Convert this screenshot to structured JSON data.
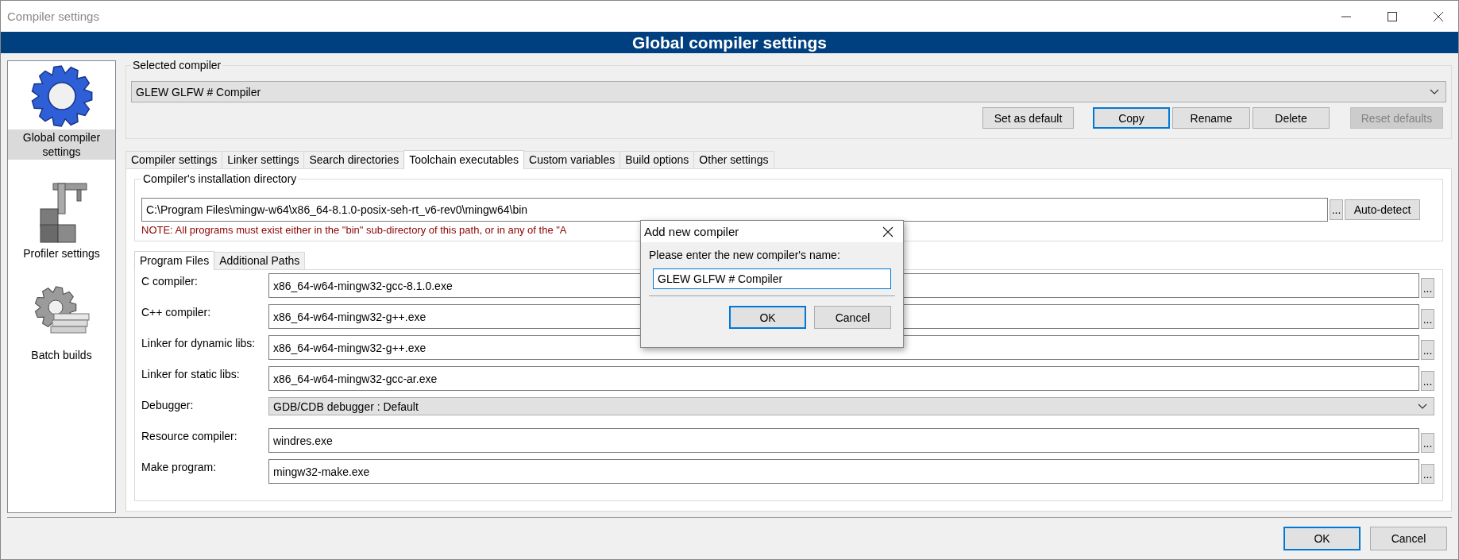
{
  "window": {
    "title": "Compiler settings"
  },
  "header": {
    "title": "Global compiler settings"
  },
  "sidebar": {
    "items": [
      {
        "label": "Global compiler settings",
        "selected": true
      },
      {
        "label": "Profiler settings",
        "selected": false
      },
      {
        "label": "Batch builds",
        "selected": false
      }
    ]
  },
  "selected_compiler": {
    "label": "Selected compiler",
    "value": "GLEW GLFW # Compiler",
    "buttons": [
      {
        "label": "Set as default",
        "focused": false,
        "disabled": false
      },
      {
        "label": "Copy",
        "focused": true,
        "disabled": false
      },
      {
        "label": "Rename",
        "focused": false,
        "disabled": false
      },
      {
        "label": "Delete",
        "focused": false,
        "disabled": false
      },
      {
        "label": "Reset defaults",
        "focused": false,
        "disabled": true
      }
    ]
  },
  "tabs": [
    {
      "label": "Compiler settings",
      "selected": false
    },
    {
      "label": "Linker settings",
      "selected": false
    },
    {
      "label": "Search directories",
      "selected": false
    },
    {
      "label": "Toolchain executables",
      "selected": true
    },
    {
      "label": "Custom variables",
      "selected": false
    },
    {
      "label": "Build options",
      "selected": false
    },
    {
      "label": "Other settings",
      "selected": false
    }
  ],
  "installation_directory": {
    "label": "Compiler's installation directory",
    "value": "C:\\Program Files\\mingw-w64\\x86_64-8.1.0-posix-seh-rt_v6-rev0\\mingw64\\bin",
    "browse": "...",
    "autodetect": "Auto-detect",
    "note": "NOTE: All programs must exist either in the \"bin\" sub-directory of this path, or in any of the \"A"
  },
  "sub_tabs": [
    {
      "label": "Program Files",
      "selected": true
    },
    {
      "label": "Additional Paths",
      "selected": false
    }
  ],
  "program_files": [
    {
      "kind": "file",
      "label": "C compiler:",
      "value": "x86_64-w64-mingw32-gcc-8.1.0.exe",
      "browse": "..."
    },
    {
      "kind": "file",
      "label": "C++ compiler:",
      "value": "x86_64-w64-mingw32-g++.exe",
      "browse": "..."
    },
    {
      "kind": "file",
      "label": "Linker for dynamic libs:",
      "value": "x86_64-w64-mingw32-g++.exe",
      "browse": "..."
    },
    {
      "kind": "file",
      "label": "Linker for static libs:",
      "value": "x86_64-w64-mingw32-gcc-ar.exe",
      "browse": "..."
    },
    {
      "kind": "combo",
      "label": "Debugger:",
      "value": "GDB/CDB debugger : Default"
    },
    {
      "kind": "file",
      "label": "Resource compiler:",
      "value": "windres.exe",
      "browse": "..."
    },
    {
      "kind": "file",
      "label": "Make program:",
      "value": "mingw32-make.exe",
      "browse": "..."
    }
  ],
  "dialog": {
    "title": "Add new compiler",
    "prompt": "Please enter the new compiler's name:",
    "value": "GLEW GLFW # Compiler",
    "buttons": [
      {
        "label": "OK",
        "focused": true
      },
      {
        "label": "Cancel",
        "focused": false
      }
    ]
  },
  "footer_buttons": [
    {
      "label": "OK",
      "focused": true
    },
    {
      "label": "Cancel",
      "focused": false
    }
  ]
}
